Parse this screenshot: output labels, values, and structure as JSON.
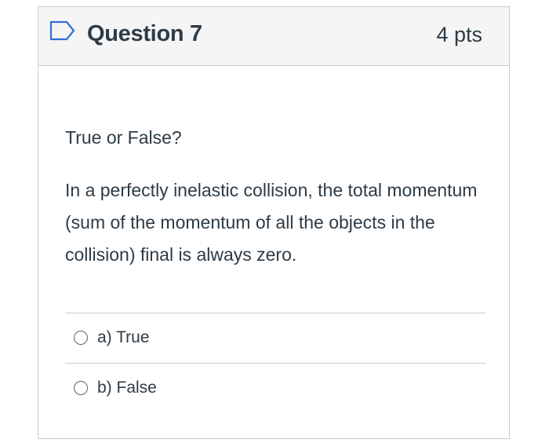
{
  "question": {
    "title": "Question 7",
    "points": "4 pts",
    "flag_icon": "flag-icon",
    "prompt": "True or False?",
    "text": "In a perfectly inelastic collision, the total momentum (sum of the momentum of all the objects in the collision) final is always zero.",
    "answers": [
      {
        "label": "a) True",
        "selected": false
      },
      {
        "label": "b) False",
        "selected": false
      }
    ]
  },
  "colors": {
    "text": "#2d3b45",
    "header_bg": "#f5f5f5",
    "border": "#c7cdd1",
    "flag_stroke": "#2d6fd2"
  }
}
